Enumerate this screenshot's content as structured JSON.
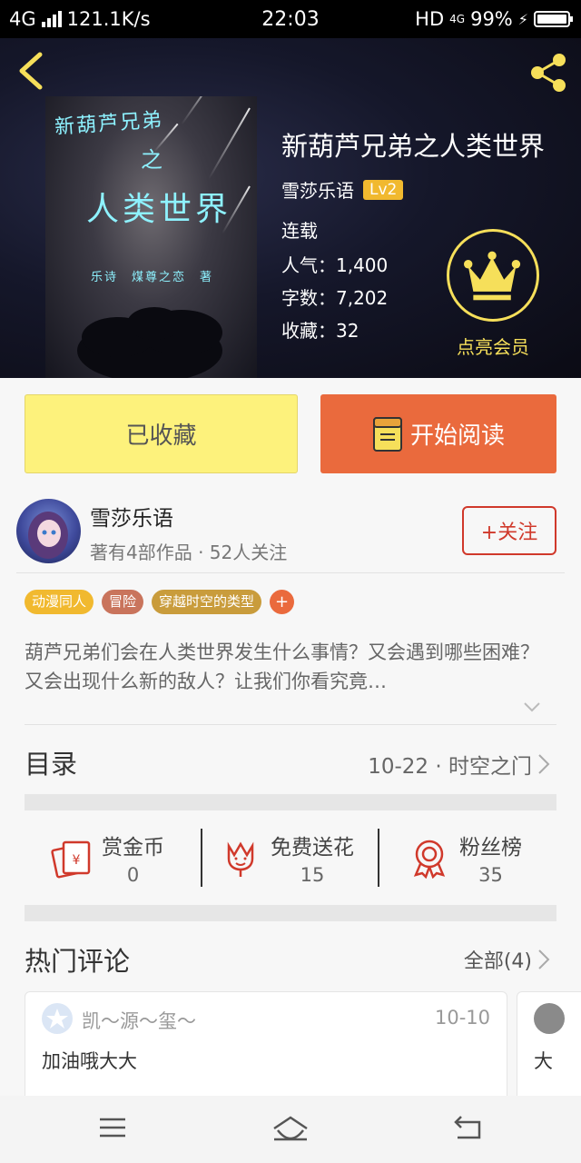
{
  "status_bar": {
    "network": "4G",
    "speed": "121.1K/s",
    "time": "22:03",
    "hd": "HD",
    "net2": "4G",
    "battery": "99%"
  },
  "book": {
    "title": "新葫芦兄弟之人类世界",
    "author": "雪莎乐语",
    "level": "Lv2",
    "status": "连载",
    "popularity": "人气：1,400",
    "word_count": "字数：7,202",
    "favorites": "收藏：32",
    "cover_line1": "新葫芦兄弟",
    "cover_line2": "之",
    "cover_line3": "人类世界",
    "cover_author": "乐诗　煤尊之恋　著"
  },
  "vip": {
    "label": "点亮会员"
  },
  "actions": {
    "favorited": "已收藏",
    "start_reading": "开始阅读"
  },
  "author_card": {
    "name": "雪莎乐语",
    "sub": "著有4部作品 · 52人关注",
    "follow": "+关注"
  },
  "tags": [
    {
      "label": "动漫同人",
      "color": "#f1b92f"
    },
    {
      "label": "冒险",
      "color": "#c9745c"
    },
    {
      "label": "穿越时空的类型",
      "color": "#c99c3c"
    }
  ],
  "tag_add": "+",
  "description": "葫芦兄弟们会在人类世界发生什么事情？又会遇到哪些困难？又会出现什么新的敌人？让我们你看究竟…",
  "toc": {
    "label": "目录",
    "latest": "10-22 · 时空之门"
  },
  "stats": [
    {
      "label": "赏金币",
      "value": "0",
      "icon": "red-envelope-icon"
    },
    {
      "label": "免费送花",
      "value": "15",
      "icon": "flower-icon"
    },
    {
      "label": "粉丝榜",
      "value": "35",
      "icon": "medal-icon"
    }
  ],
  "comments": {
    "label": "热门评论",
    "all": "全部(4)",
    "items": [
      {
        "user": "凯～源～玺～",
        "date": "10-10",
        "text": "加油哦大大"
      },
      {
        "user": "",
        "date": "",
        "text": "大"
      }
    ]
  },
  "colors": {
    "accent": "#ea6a3d",
    "fav_yellow": "#fdf27c",
    "vip_gold": "#f6df5a",
    "follow_red": "#d0392b"
  }
}
